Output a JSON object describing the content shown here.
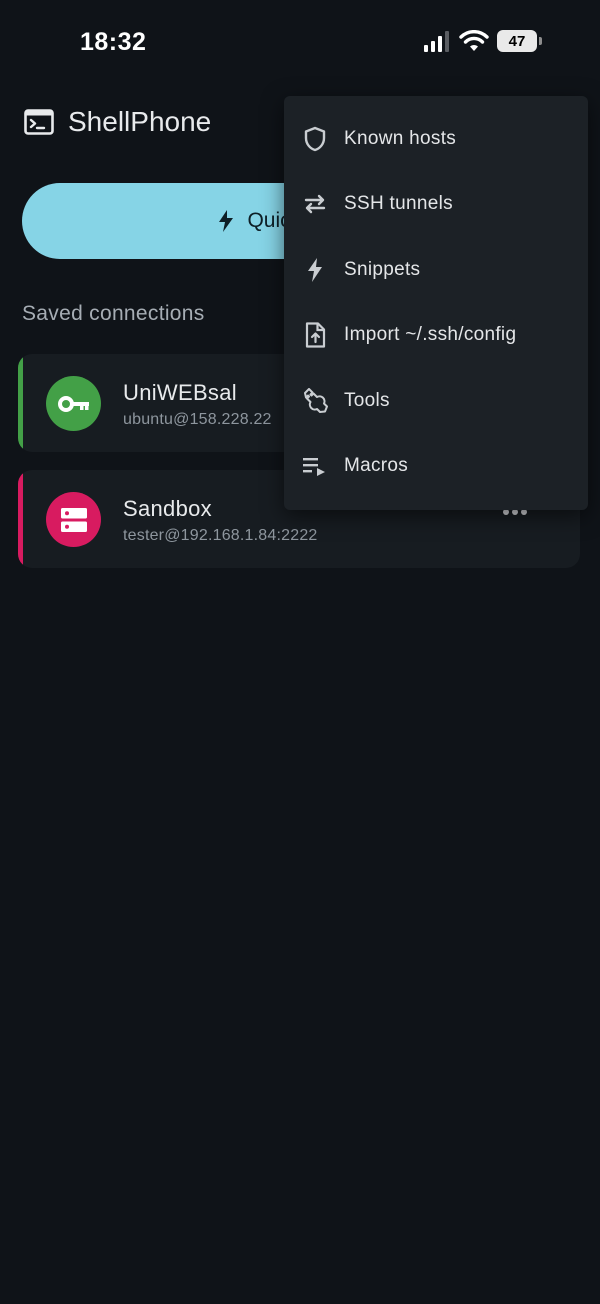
{
  "status_bar": {
    "time": "18:32",
    "battery": "47"
  },
  "app_bar": {
    "title": "ShellPhone"
  },
  "quick_connect": {
    "label": "Quick connect"
  },
  "saved_connections": {
    "title": "Saved connections",
    "items": [
      {
        "name": "UniWEBsal",
        "address": "ubuntu@158.228.22",
        "accent": "#43a047",
        "avatar_color": "#43a047",
        "icon": "key-icon"
      },
      {
        "name": "Sandbox",
        "address": "tester@192.168.1.84:2222",
        "accent": "#d81b60",
        "avatar_color": "#d81b60",
        "icon": "server-icon"
      }
    ]
  },
  "menu": {
    "items": [
      {
        "label": "Known hosts",
        "icon": "shield-icon"
      },
      {
        "label": "SSH tunnels",
        "icon": "swap-arrows-icon"
      },
      {
        "label": "Snippets",
        "icon": "bolt-icon"
      },
      {
        "label": "Import ~/.ssh/config",
        "icon": "file-upload-icon"
      },
      {
        "label": "Tools",
        "icon": "wrench-icon"
      },
      {
        "label": "Macros",
        "icon": "playlist-play-icon"
      }
    ]
  },
  "colors": {
    "background": "#0f1318",
    "quick_connect": "#86d4e6",
    "menu_bg": "#1c2126",
    "card_bg": "#171c21"
  }
}
